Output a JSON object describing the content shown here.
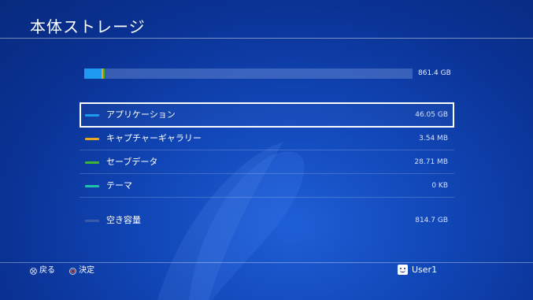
{
  "header": {
    "title": "本体ストレージ"
  },
  "storage": {
    "total": "861.4 GB",
    "used_fraction": 0.055,
    "segments": [
      {
        "name": "application",
        "fraction": 0.0535,
        "color": "#1e9bf0"
      },
      {
        "name": "capture",
        "fraction": 0.003,
        "color": "#e8a71c"
      },
      {
        "name": "savedata",
        "fraction": 0.003,
        "color": "#3fb52f"
      }
    ],
    "bar_bg_color": "#5a7cc8"
  },
  "categories": [
    {
      "label": "アプリケーション",
      "size": "46.05 GB",
      "color": "#1e9bf0",
      "selected": true
    },
    {
      "label": "キャプチャーギャラリー",
      "size": "3.54 MB",
      "color": "#e8a71c",
      "selected": false
    },
    {
      "label": "セーブデータ",
      "size": "28.71 MB",
      "color": "#3fb52f",
      "selected": false
    },
    {
      "label": "テーマ",
      "size": "0 KB",
      "color": "#1fc4a8",
      "selected": false
    }
  ],
  "free": {
    "label": "空き容量",
    "size": "814.7 GB",
    "color": "#3a5aa8"
  },
  "footer": {
    "back_label": "戻る",
    "back_icon": "cross-button-icon",
    "confirm_label": "決定",
    "confirm_icon": "circle-button-icon",
    "user_name": "User1",
    "user_icon": "avatar-icon"
  }
}
